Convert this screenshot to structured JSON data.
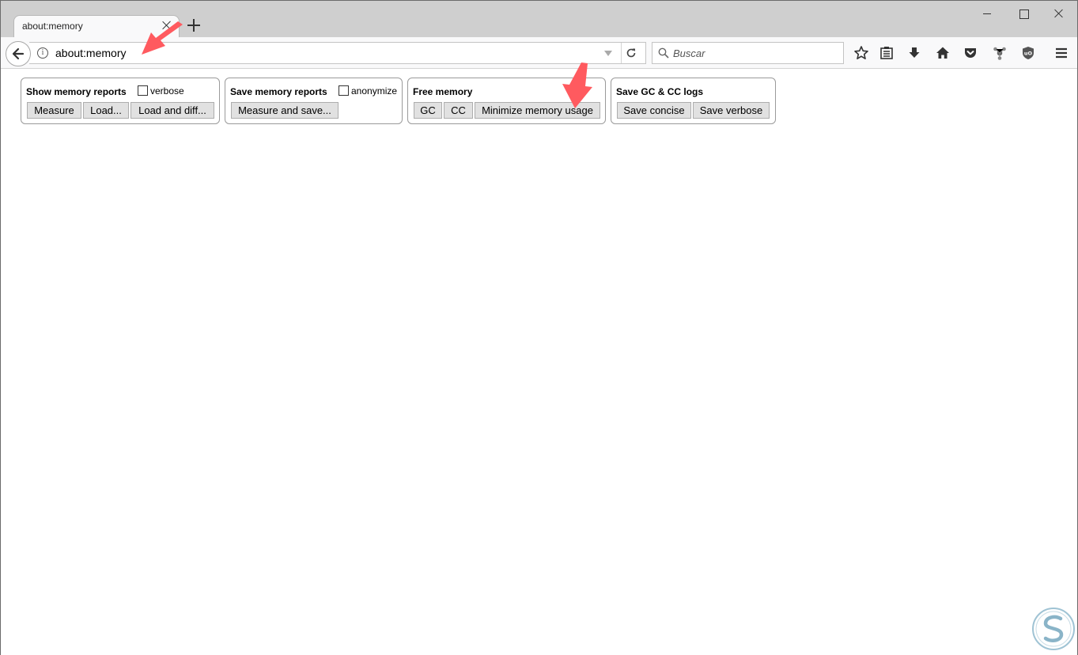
{
  "browser": {
    "tab": {
      "title": "about:memory"
    },
    "url": "about:memory",
    "search": {
      "placeholder": "Buscar"
    }
  },
  "toolbar_icons": [
    "star-icon",
    "reading-list-icon",
    "download-icon",
    "home-icon",
    "pocket-icon",
    "addon-icon",
    "ublock-icon",
    "menu-icon"
  ],
  "sections": {
    "show": {
      "title": "Show memory reports",
      "checkbox_label": "verbose",
      "buttons": [
        "Measure",
        "Load...",
        "Load and diff..."
      ]
    },
    "save": {
      "title": "Save memory reports",
      "checkbox_label": "anonymize",
      "buttons": [
        "Measure and save..."
      ]
    },
    "free": {
      "title": "Free memory",
      "buttons": [
        "GC",
        "CC",
        "Minimize memory usage"
      ]
    },
    "logs": {
      "title": "Save GC & CC logs",
      "buttons": [
        "Save concise",
        "Save verbose"
      ]
    }
  },
  "colors": {
    "annotation_arrow": "#ff5a5f",
    "logo": "#8ab4c8"
  }
}
